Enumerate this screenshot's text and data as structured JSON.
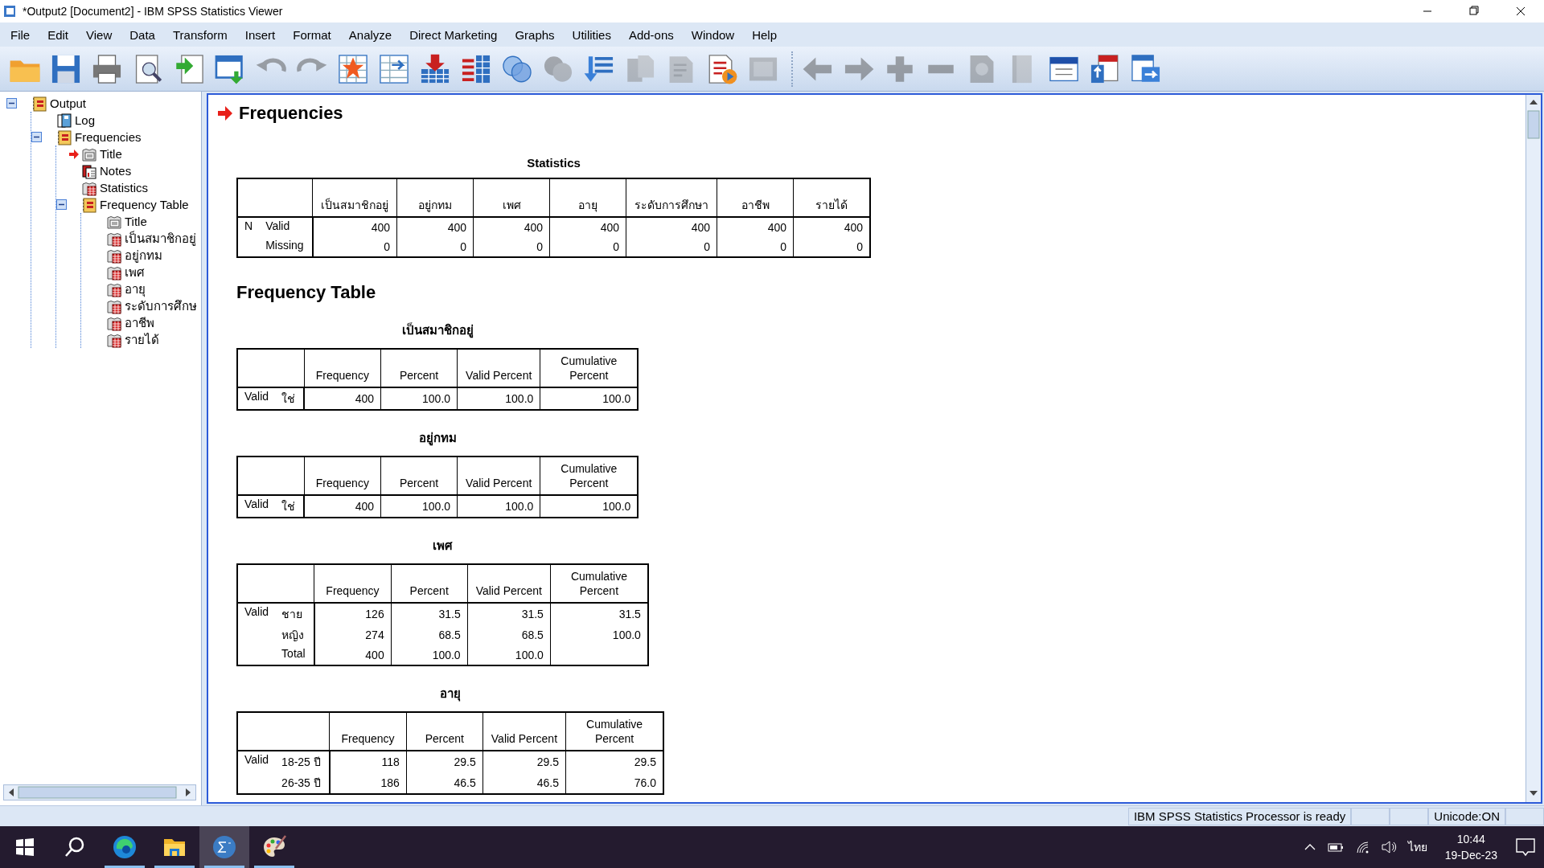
{
  "window": {
    "title": "*Output2 [Document2] - IBM SPSS Statistics Viewer"
  },
  "menu": [
    "File",
    "Edit",
    "View",
    "Data",
    "Transform",
    "Insert",
    "Format",
    "Analyze",
    "Direct Marketing",
    "Graphs",
    "Utilities",
    "Add-ons",
    "Window",
    "Help"
  ],
  "toolbar": [
    [
      {
        "disabled": false
      },
      {
        "disabled": false
      },
      {
        "disabled": false
      },
      {
        "disabled": false
      },
      {
        "disabled": false
      },
      {
        "disabled": false
      },
      {
        "disabled": true
      },
      {
        "disabled": true
      },
      {
        "disabled": false
      },
      {
        "disabled": false
      },
      {
        "disabled": false
      },
      {
        "disabled": false
      },
      {
        "disabled": false
      },
      {
        "disabled": true
      },
      {
        "disabled": false
      },
      {
        "disabled": true
      },
      {
        "disabled": true
      },
      {
        "disabled": false
      },
      {
        "disabled": true
      }
    ],
    [
      {
        "disabled": true
      },
      {
        "disabled": true
      },
      {
        "disabled": true
      },
      {
        "disabled": true
      },
      {
        "disabled": true
      },
      {
        "disabled": true
      },
      {
        "disabled": false
      },
      {
        "disabled": false
      },
      {
        "disabled": false
      }
    ]
  ],
  "tree": [
    {
      "label": "Output",
      "kind": "book",
      "expanded": true,
      "current": false,
      "children": [
        {
          "label": "Log",
          "kind": "log",
          "current": false
        },
        {
          "label": "Frequencies",
          "kind": "book",
          "expanded": true,
          "current": false,
          "children": [
            {
              "label": "Title",
              "kind": "title",
              "current": true
            },
            {
              "label": "Notes",
              "kind": "notes",
              "current": false
            },
            {
              "label": "Statistics",
              "kind": "table",
              "current": false
            },
            {
              "label": "Frequency Table",
              "kind": "book",
              "expanded": true,
              "current": false,
              "children": [
                {
                  "label": "Title",
                  "kind": "title",
                  "current": false
                },
                {
                  "label": "เป็นสมาชิกอยู่",
                  "kind": "table",
                  "current": false
                },
                {
                  "label": "อยู่กทม",
                  "kind": "table",
                  "current": false
                },
                {
                  "label": "เพศ",
                  "kind": "table",
                  "current": false
                },
                {
                  "label": "อายุ",
                  "kind": "table",
                  "current": false
                },
                {
                  "label": "ระดับการศึกษ",
                  "kind": "table",
                  "current": false
                },
                {
                  "label": "อาชีพ",
                  "kind": "table",
                  "current": false
                },
                {
                  "label": "รายได้",
                  "kind": "table",
                  "current": false
                }
              ]
            }
          ]
        }
      ]
    }
  ],
  "output": {
    "heading": "Frequencies",
    "statistics": {
      "title": "Statistics",
      "columns": [
        "เป็นสมาชิกอยู่",
        "อยู่กทม",
        "เพศ",
        "อายุ",
        "ระดับการศึกษา",
        "อาชีพ",
        "รายได้"
      ],
      "rows": [
        {
          "group": "N",
          "label": "Valid",
          "values": [
            "400",
            "400",
            "400",
            "400",
            "400",
            "400",
            "400"
          ]
        },
        {
          "label": "Missing",
          "values": [
            "0",
            "0",
            "0",
            "0",
            "0",
            "0",
            "0"
          ]
        }
      ]
    },
    "section_heading": "Frequency Table",
    "frequency_tables": [
      {
        "title": "เป็นสมาชิกอยู่",
        "columns": [
          "Frequency",
          "Percent",
          "Valid Percent",
          "Cumulative Percent"
        ],
        "rows": [
          {
            "group": "Valid",
            "label": "ใช่",
            "values": [
              "400",
              "100.0",
              "100.0",
              "100.0"
            ]
          }
        ]
      },
      {
        "title": "อยู่กทม",
        "columns": [
          "Frequency",
          "Percent",
          "Valid Percent",
          "Cumulative Percent"
        ],
        "rows": [
          {
            "group": "Valid",
            "label": "ใช่",
            "values": [
              "400",
              "100.0",
              "100.0",
              "100.0"
            ]
          }
        ]
      },
      {
        "title": "เพศ",
        "columns": [
          "Frequency",
          "Percent",
          "Valid Percent",
          "Cumulative Percent"
        ],
        "rows": [
          {
            "group": "Valid",
            "label": "ชาย",
            "values": [
              "126",
              "31.5",
              "31.5",
              "31.5"
            ]
          },
          {
            "label": "หญิง",
            "values": [
              "274",
              "68.5",
              "68.5",
              "100.0"
            ]
          },
          {
            "label": "Total",
            "values": [
              "400",
              "100.0",
              "100.0"
            ]
          }
        ]
      },
      {
        "title": "อายุ",
        "columns": [
          "Frequency",
          "Percent",
          "Valid Percent",
          "Cumulative Percent"
        ],
        "rows": [
          {
            "group": "Valid",
            "label": "18-25 ปี",
            "values": [
              "118",
              "29.5",
              "29.5",
              "29.5"
            ]
          },
          {
            "label": "26-35 ปี",
            "values": [
              "186",
              "46.5",
              "46.5",
              "76.0"
            ]
          }
        ]
      }
    ]
  },
  "status_bar": {
    "message": "IBM SPSS Statistics Processor is ready",
    "encoding": "Unicode:ON"
  },
  "taskbar": {
    "apps": [
      {
        "running": true,
        "active": false
      },
      {
        "running": true,
        "active": false
      },
      {
        "running": true,
        "active": true
      },
      {
        "running": true,
        "active": false
      }
    ],
    "tray": {
      "language": "ไทย",
      "time": "10:44",
      "date": "19-Dec-23"
    }
  }
}
